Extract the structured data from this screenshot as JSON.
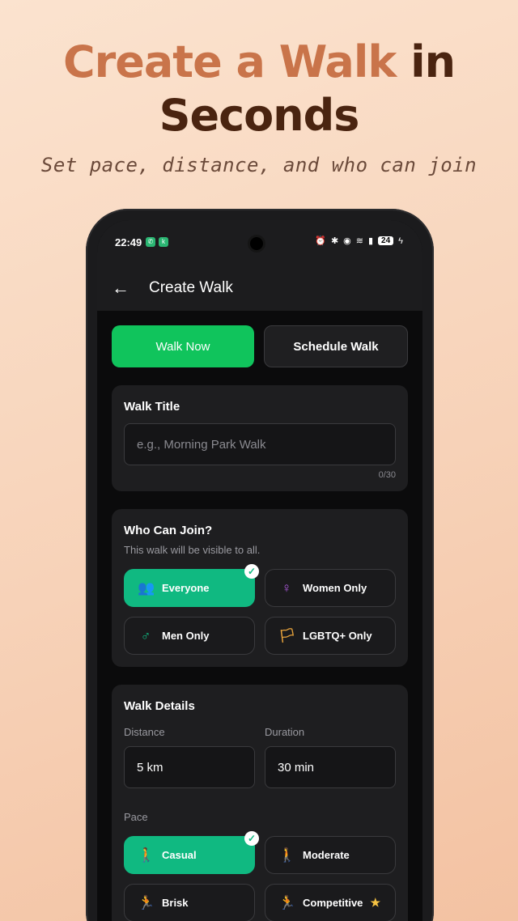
{
  "hero": {
    "title_highlight": "Create a Walk",
    "title_dark_1": "in",
    "title_dark_2": "Seconds",
    "subtitle": "Set pace, distance, and who can join"
  },
  "status_bar": {
    "time": "22:49",
    "battery": "24"
  },
  "appbar": {
    "back_icon": "←",
    "title": "Create Walk"
  },
  "mode_toggle": {
    "walk_now": "Walk Now",
    "schedule_walk": "Schedule Walk",
    "selected": "walk_now"
  },
  "walk_title": {
    "label": "Walk Title",
    "placeholder": "e.g., Morning Park Walk",
    "counter": "0/30"
  },
  "who_can_join": {
    "title": "Who Can Join?",
    "subtitle": "This walk will be visible to all.",
    "options": [
      {
        "label": "Everyone",
        "icon": "👥",
        "selected": true
      },
      {
        "label": "Women Only",
        "icon": "♀",
        "selected": false
      },
      {
        "label": "Men Only",
        "icon": "♂",
        "selected": false
      },
      {
        "label": "LGBTQ+ Only",
        "icon": "🏳",
        "selected": false
      }
    ]
  },
  "walk_details": {
    "title": "Walk Details",
    "distance_label": "Distance",
    "distance_value": "5 km",
    "duration_label": "Duration",
    "duration_value": "30 min",
    "pace_label": "Pace",
    "pace_options": [
      {
        "label": "Casual",
        "icon": "🚶",
        "selected": true
      },
      {
        "label": "Moderate",
        "icon": "🚶",
        "selected": false
      },
      {
        "label": "Brisk",
        "icon": "🏃",
        "selected": false
      },
      {
        "label": "Competitive",
        "icon": "🏃",
        "selected": false,
        "star": "★"
      }
    ]
  },
  "colors": {
    "accent_green": "#10c45c",
    "selected_teal": "#10b981",
    "hero_highlight": "#c9744a",
    "hero_dark": "#4a2410"
  }
}
